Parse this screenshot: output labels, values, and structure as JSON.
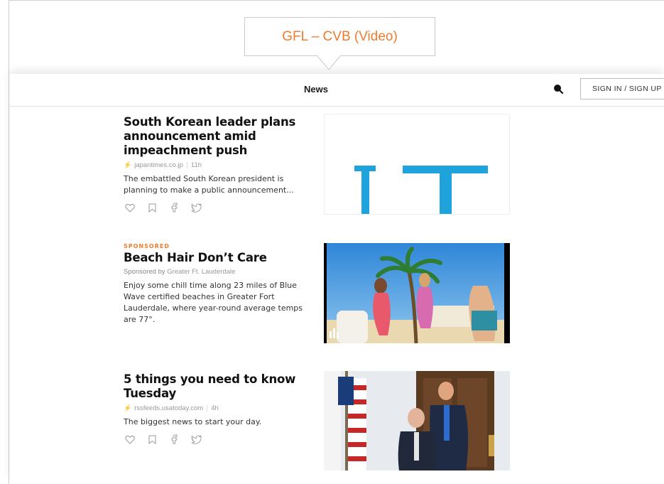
{
  "callout": {
    "label": "GFL – CVB (Video)"
  },
  "header": {
    "title": "News",
    "signin_label": "SIGN IN / SIGN UP"
  },
  "articles": [
    {
      "headline": "South Korean leader plans announcement amid impeachment push",
      "source": "japantimes.co.jp",
      "age": "11h",
      "summary": "The embattled South Korean president is planning to make a public announcement...",
      "thumb_text": "IT"
    },
    {
      "tag": "SPONSORED",
      "headline": "Beach Hair Don’t Care",
      "sponsor_prefix": "Sponsored by",
      "sponsor_name": "Greater Ft. Lauderdale",
      "summary": "Enjoy some chill time along 23 miles of Blue Wave certified beaches in Greater Fort Lauderdale, where year-round average temps are 77°."
    },
    {
      "headline": "5 things you need to know Tuesday",
      "source": "rssfeeds.usatoday.com",
      "age": "4h",
      "summary": "The biggest news to start your day."
    }
  ],
  "colors": {
    "accent": "#f07b2c",
    "thumb_blue": "#1fa3dd"
  },
  "icons": [
    "search-icon",
    "lightning-icon",
    "heart-icon",
    "bookmark-icon",
    "facebook-icon",
    "twitter-icon"
  ]
}
